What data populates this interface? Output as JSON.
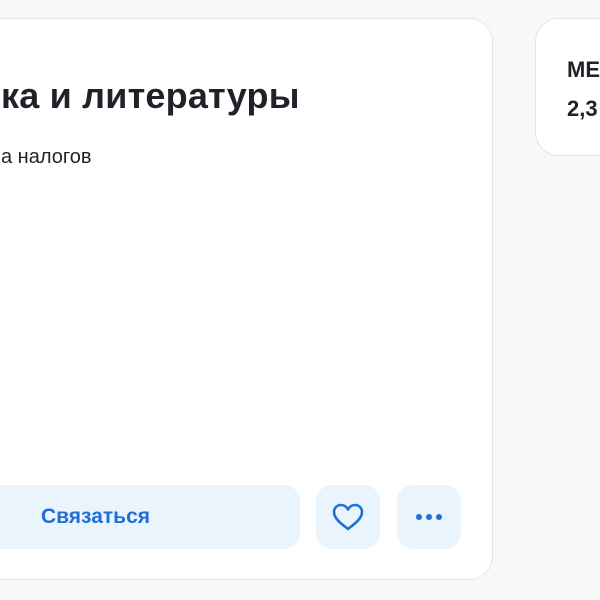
{
  "main_card": {
    "title": "ка и литературы",
    "salary_note": "а налогов",
    "contact_button_label": "Связаться",
    "favorite_icon": "heart-icon",
    "more_icon": "more-dots-icon"
  },
  "side_card": {
    "title": "МЕ",
    "subtitle": "2,3"
  },
  "colors": {
    "accent": "#1f6fd6",
    "button_bg": "#eaf4fd",
    "text": "#1f2329",
    "border": "#e3e5ea",
    "page_bg": "#f7f8fa"
  }
}
